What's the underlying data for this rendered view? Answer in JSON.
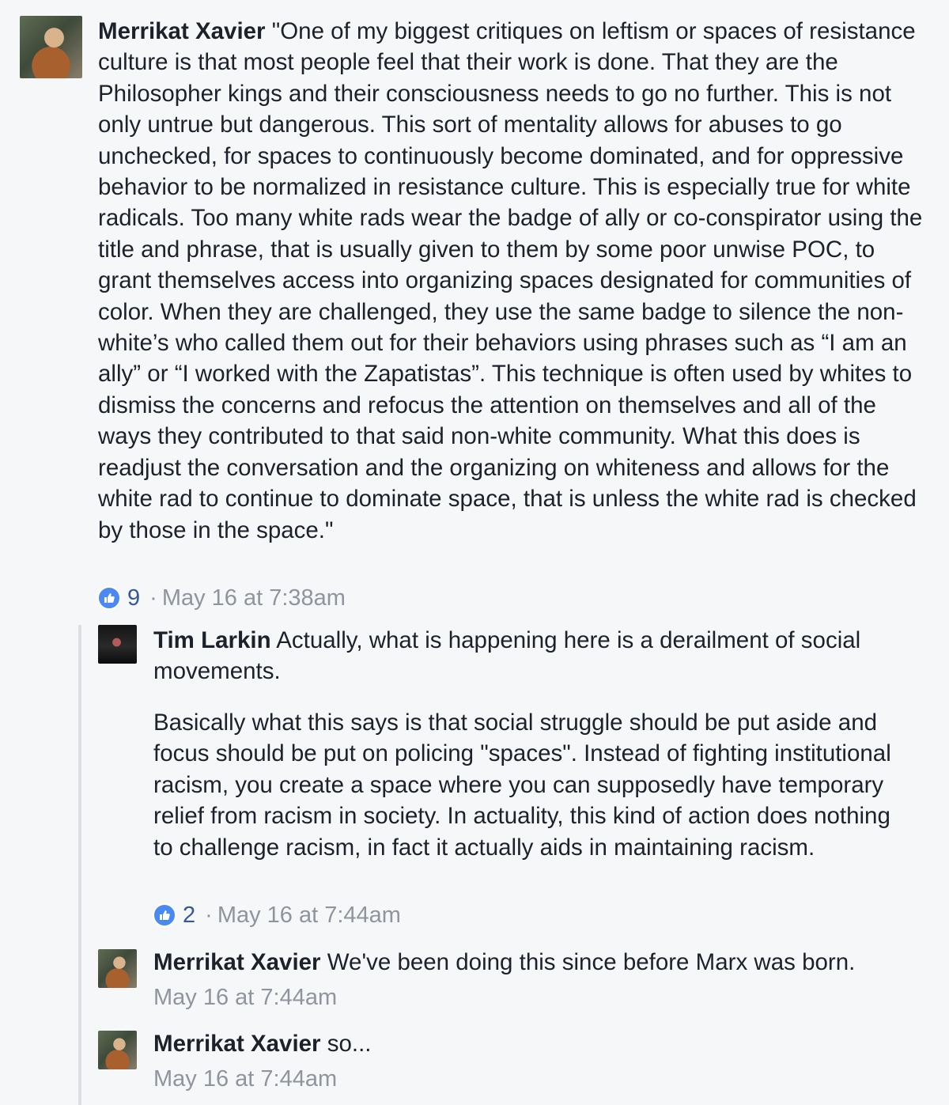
{
  "comments": [
    {
      "author": "Merrikat Xavier",
      "text": "\"One of my biggest critiques on leftism or spaces of resistance culture is that most people feel that their work is done. That they are the Philosopher kings and their consciousness needs to go no further. This is not only untrue but dangerous. This sort of mentality allows for abuses to go unchecked, for spaces to continuously become dominated, and for oppressive behavior to be normalized in resistance culture. This is especially true for white radicals. Too many white rads wear the badge of ally or co-conspirator using the title and phrase, that is usually given to them by some poor unwise POC, to grant themselves access into organizing spaces designated for communities of color. When they are challenged, they use the same badge to silence the non-white’s who called them out for their behaviors using phrases such as “I am an ally” or “I worked with the Zapatistas”. This technique is often used by whites to dismiss the concerns and refocus the attention on themselves and all of the ways they contributed to that said non-white community. What this does is readjust the conversation and the organizing on whiteness and allows for the white rad to continue to dominate space, that is unless the white rad is checked by those in the space.\"",
      "likes": "9",
      "timestamp": "May 16 at 7:38am",
      "avatar_icon": "profile-photo"
    }
  ],
  "replies": [
    {
      "author": "Tim Larkin",
      "text_p1": "Actually, what is happening here is a derailment of social movements.",
      "text_p2": "Basically what this says is that social struggle should be put aside and focus should be put on policing \"spaces\". Instead of fighting institutional racism, you create a space where you can supposedly have temporary relief from racism in society. In actuality, this kind of action does nothing to challenge racism, in fact it actually aids in maintaining racism.",
      "likes": "2",
      "timestamp": "May 16 at 7:44am",
      "avatar_icon": "flag-photo"
    },
    {
      "author": "Merrikat Xavier",
      "text": "We've been doing this since before Marx was born.",
      "timestamp": "May 16 at 7:44am",
      "avatar_icon": "profile-photo"
    },
    {
      "author": "Merrikat Xavier",
      "text": "so...",
      "timestamp": "May 16 at 7:44am",
      "avatar_icon": "profile-photo"
    }
  ],
  "colors": {
    "background": "#f6f7f9",
    "text": "#1d2129",
    "meta": "#90949c",
    "like": "#4a89f3",
    "like_count": "#365899"
  }
}
